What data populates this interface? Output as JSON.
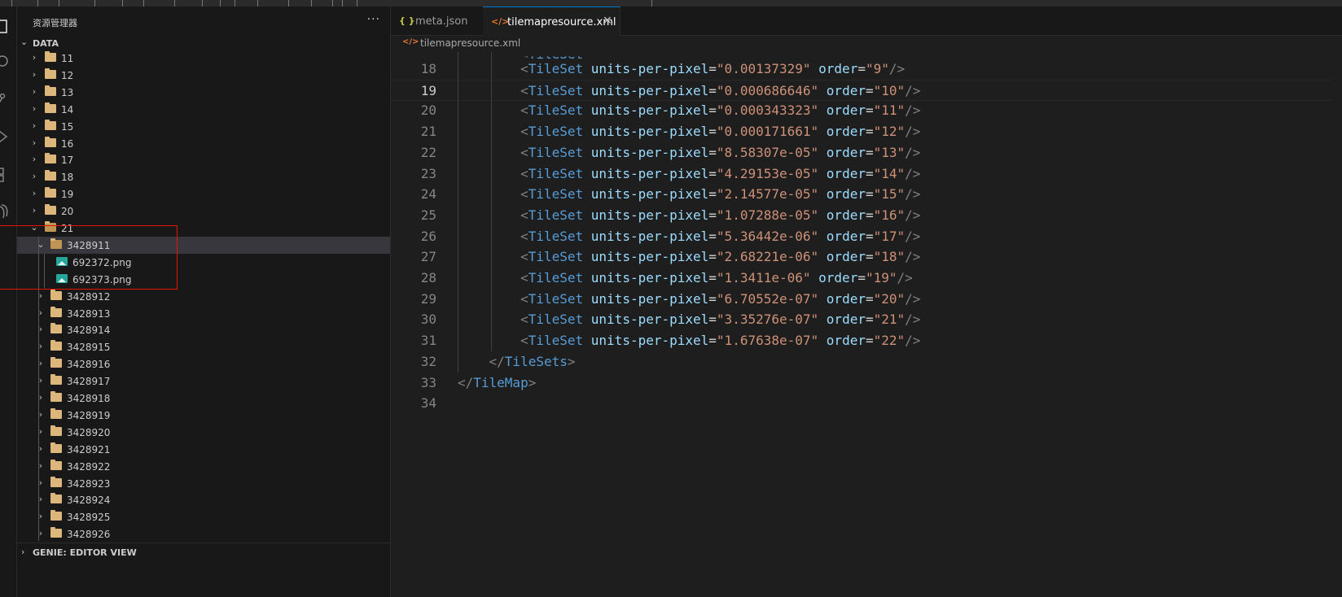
{
  "sidebar": {
    "title": "资源管理器",
    "more": "···",
    "section_label": "DATA",
    "tree": [
      {
        "label": "11",
        "type": "folder",
        "expanded": false,
        "depth": 1
      },
      {
        "label": "12",
        "type": "folder",
        "expanded": false,
        "depth": 1
      },
      {
        "label": "13",
        "type": "folder",
        "expanded": false,
        "depth": 1
      },
      {
        "label": "14",
        "type": "folder",
        "expanded": false,
        "depth": 1
      },
      {
        "label": "15",
        "type": "folder",
        "expanded": false,
        "depth": 1
      },
      {
        "label": "16",
        "type": "folder",
        "expanded": false,
        "depth": 1
      },
      {
        "label": "17",
        "type": "folder",
        "expanded": false,
        "depth": 1
      },
      {
        "label": "18",
        "type": "folder",
        "expanded": false,
        "depth": 1
      },
      {
        "label": "19",
        "type": "folder",
        "expanded": false,
        "depth": 1
      },
      {
        "label": "20",
        "type": "folder",
        "expanded": false,
        "depth": 1
      },
      {
        "label": "21",
        "type": "folder",
        "expanded": true,
        "depth": 1
      },
      {
        "label": "3428911",
        "type": "folder",
        "expanded": true,
        "depth": 2,
        "selected": true
      },
      {
        "label": "692372.png",
        "type": "image",
        "depth": 3
      },
      {
        "label": "692373.png",
        "type": "image",
        "depth": 3
      },
      {
        "label": "3428912",
        "type": "folder",
        "expanded": false,
        "depth": 2
      },
      {
        "label": "3428913",
        "type": "folder",
        "expanded": false,
        "depth": 2
      },
      {
        "label": "3428914",
        "type": "folder",
        "expanded": false,
        "depth": 2
      },
      {
        "label": "3428915",
        "type": "folder",
        "expanded": false,
        "depth": 2
      },
      {
        "label": "3428916",
        "type": "folder",
        "expanded": false,
        "depth": 2
      },
      {
        "label": "3428917",
        "type": "folder",
        "expanded": false,
        "depth": 2
      },
      {
        "label": "3428918",
        "type": "folder",
        "expanded": false,
        "depth": 2
      },
      {
        "label": "3428919",
        "type": "folder",
        "expanded": false,
        "depth": 2
      },
      {
        "label": "3428920",
        "type": "folder",
        "expanded": false,
        "depth": 2
      },
      {
        "label": "3428921",
        "type": "folder",
        "expanded": false,
        "depth": 2
      },
      {
        "label": "3428922",
        "type": "folder",
        "expanded": false,
        "depth": 2
      },
      {
        "label": "3428923",
        "type": "folder",
        "expanded": false,
        "depth": 2
      },
      {
        "label": "3428924",
        "type": "folder",
        "expanded": false,
        "depth": 2
      },
      {
        "label": "3428925",
        "type": "folder",
        "expanded": false,
        "depth": 2
      },
      {
        "label": "3428926",
        "type": "folder",
        "expanded": false,
        "depth": 2
      }
    ],
    "genie_label": "GENIE: EDITOR VIEW"
  },
  "tabs": [
    {
      "icon": "{ }",
      "label": "meta.json",
      "active": false
    },
    {
      "icon": "</>",
      "label": "tilemapresource.xml",
      "active": true
    }
  ],
  "breadcrumb": {
    "icon": "</>",
    "label": "tilemapresource.xml"
  },
  "editor": {
    "current_line": 19,
    "lines": [
      {
        "n": 18,
        "indent": "        ",
        "tokens": [
          [
            "p",
            "<"
          ],
          [
            "t",
            "TileSet"
          ],
          [
            "e",
            " "
          ],
          [
            "a",
            "units-per-pixel"
          ],
          [
            "e",
            "="
          ],
          [
            "v",
            "\"0.00137329\""
          ],
          [
            "e",
            " "
          ],
          [
            "a",
            "order"
          ],
          [
            "e",
            "="
          ],
          [
            "v",
            "\"9\""
          ],
          [
            "p",
            "/>"
          ]
        ]
      },
      {
        "n": 19,
        "indent": "        ",
        "tokens": [
          [
            "p",
            "<"
          ],
          [
            "t",
            "TileSet"
          ],
          [
            "e",
            " "
          ],
          [
            "a",
            "units-per-pixel"
          ],
          [
            "e",
            "="
          ],
          [
            "v",
            "\"0.000686646\""
          ],
          [
            "e",
            " "
          ],
          [
            "a",
            "order"
          ],
          [
            "e",
            "="
          ],
          [
            "v",
            "\"10\""
          ],
          [
            "p",
            "/>"
          ]
        ]
      },
      {
        "n": 20,
        "indent": "        ",
        "tokens": [
          [
            "p",
            "<"
          ],
          [
            "t",
            "TileSet"
          ],
          [
            "e",
            " "
          ],
          [
            "a",
            "units-per-pixel"
          ],
          [
            "e",
            "="
          ],
          [
            "v",
            "\"0.000343323\""
          ],
          [
            "e",
            " "
          ],
          [
            "a",
            "order"
          ],
          [
            "e",
            "="
          ],
          [
            "v",
            "\"11\""
          ],
          [
            "p",
            "/>"
          ]
        ]
      },
      {
        "n": 21,
        "indent": "        ",
        "tokens": [
          [
            "p",
            "<"
          ],
          [
            "t",
            "TileSet"
          ],
          [
            "e",
            " "
          ],
          [
            "a",
            "units-per-pixel"
          ],
          [
            "e",
            "="
          ],
          [
            "v",
            "\"0.000171661\""
          ],
          [
            "e",
            " "
          ],
          [
            "a",
            "order"
          ],
          [
            "e",
            "="
          ],
          [
            "v",
            "\"12\""
          ],
          [
            "p",
            "/>"
          ]
        ]
      },
      {
        "n": 22,
        "indent": "        ",
        "tokens": [
          [
            "p",
            "<"
          ],
          [
            "t",
            "TileSet"
          ],
          [
            "e",
            " "
          ],
          [
            "a",
            "units-per-pixel"
          ],
          [
            "e",
            "="
          ],
          [
            "v",
            "\"8.58307e-05\""
          ],
          [
            "e",
            " "
          ],
          [
            "a",
            "order"
          ],
          [
            "e",
            "="
          ],
          [
            "v",
            "\"13\""
          ],
          [
            "p",
            "/>"
          ]
        ]
      },
      {
        "n": 23,
        "indent": "        ",
        "tokens": [
          [
            "p",
            "<"
          ],
          [
            "t",
            "TileSet"
          ],
          [
            "e",
            " "
          ],
          [
            "a",
            "units-per-pixel"
          ],
          [
            "e",
            "="
          ],
          [
            "v",
            "\"4.29153e-05\""
          ],
          [
            "e",
            " "
          ],
          [
            "a",
            "order"
          ],
          [
            "e",
            "="
          ],
          [
            "v",
            "\"14\""
          ],
          [
            "p",
            "/>"
          ]
        ]
      },
      {
        "n": 24,
        "indent": "        ",
        "tokens": [
          [
            "p",
            "<"
          ],
          [
            "t",
            "TileSet"
          ],
          [
            "e",
            " "
          ],
          [
            "a",
            "units-per-pixel"
          ],
          [
            "e",
            "="
          ],
          [
            "v",
            "\"2.14577e-05\""
          ],
          [
            "e",
            " "
          ],
          [
            "a",
            "order"
          ],
          [
            "e",
            "="
          ],
          [
            "v",
            "\"15\""
          ],
          [
            "p",
            "/>"
          ]
        ]
      },
      {
        "n": 25,
        "indent": "        ",
        "tokens": [
          [
            "p",
            "<"
          ],
          [
            "t",
            "TileSet"
          ],
          [
            "e",
            " "
          ],
          [
            "a",
            "units-per-pixel"
          ],
          [
            "e",
            "="
          ],
          [
            "v",
            "\"1.07288e-05\""
          ],
          [
            "e",
            " "
          ],
          [
            "a",
            "order"
          ],
          [
            "e",
            "="
          ],
          [
            "v",
            "\"16\""
          ],
          [
            "p",
            "/>"
          ]
        ]
      },
      {
        "n": 26,
        "indent": "        ",
        "tokens": [
          [
            "p",
            "<"
          ],
          [
            "t",
            "TileSet"
          ],
          [
            "e",
            " "
          ],
          [
            "a",
            "units-per-pixel"
          ],
          [
            "e",
            "="
          ],
          [
            "v",
            "\"5.36442e-06\""
          ],
          [
            "e",
            " "
          ],
          [
            "a",
            "order"
          ],
          [
            "e",
            "="
          ],
          [
            "v",
            "\"17\""
          ],
          [
            "p",
            "/>"
          ]
        ]
      },
      {
        "n": 27,
        "indent": "        ",
        "tokens": [
          [
            "p",
            "<"
          ],
          [
            "t",
            "TileSet"
          ],
          [
            "e",
            " "
          ],
          [
            "a",
            "units-per-pixel"
          ],
          [
            "e",
            "="
          ],
          [
            "v",
            "\"2.68221e-06\""
          ],
          [
            "e",
            " "
          ],
          [
            "a",
            "order"
          ],
          [
            "e",
            "="
          ],
          [
            "v",
            "\"18\""
          ],
          [
            "p",
            "/>"
          ]
        ]
      },
      {
        "n": 28,
        "indent": "        ",
        "tokens": [
          [
            "p",
            "<"
          ],
          [
            "t",
            "TileSet"
          ],
          [
            "e",
            " "
          ],
          [
            "a",
            "units-per-pixel"
          ],
          [
            "e",
            "="
          ],
          [
            "v",
            "\"1.3411e-06\""
          ],
          [
            "e",
            " "
          ],
          [
            "a",
            "order"
          ],
          [
            "e",
            "="
          ],
          [
            "v",
            "\"19\""
          ],
          [
            "p",
            "/>"
          ]
        ]
      },
      {
        "n": 29,
        "indent": "        ",
        "tokens": [
          [
            "p",
            "<"
          ],
          [
            "t",
            "TileSet"
          ],
          [
            "e",
            " "
          ],
          [
            "a",
            "units-per-pixel"
          ],
          [
            "e",
            "="
          ],
          [
            "v",
            "\"6.70552e-07\""
          ],
          [
            "e",
            " "
          ],
          [
            "a",
            "order"
          ],
          [
            "e",
            "="
          ],
          [
            "v",
            "\"20\""
          ],
          [
            "p",
            "/>"
          ]
        ]
      },
      {
        "n": 30,
        "indent": "        ",
        "tokens": [
          [
            "p",
            "<"
          ],
          [
            "t",
            "TileSet"
          ],
          [
            "e",
            " "
          ],
          [
            "a",
            "units-per-pixel"
          ],
          [
            "e",
            "="
          ],
          [
            "v",
            "\"3.35276e-07\""
          ],
          [
            "e",
            " "
          ],
          [
            "a",
            "order"
          ],
          [
            "e",
            "="
          ],
          [
            "v",
            "\"21\""
          ],
          [
            "p",
            "/>"
          ]
        ]
      },
      {
        "n": 31,
        "indent": "        ",
        "tokens": [
          [
            "p",
            "<"
          ],
          [
            "t",
            "TileSet"
          ],
          [
            "e",
            " "
          ],
          [
            "a",
            "units-per-pixel"
          ],
          [
            "e",
            "="
          ],
          [
            "v",
            "\"1.67638e-07\""
          ],
          [
            "e",
            " "
          ],
          [
            "a",
            "order"
          ],
          [
            "e",
            "="
          ],
          [
            "v",
            "\"22\""
          ],
          [
            "p",
            "/>"
          ]
        ]
      },
      {
        "n": 32,
        "indent": "    ",
        "tokens": [
          [
            "p",
            "</"
          ],
          [
            "t",
            "TileSets"
          ],
          [
            "p",
            ">"
          ]
        ]
      },
      {
        "n": 33,
        "indent": "",
        "tokens": [
          [
            "p",
            "</"
          ],
          [
            "t",
            "TileMap"
          ],
          [
            "p",
            ">"
          ]
        ]
      },
      {
        "n": 34,
        "indent": "",
        "tokens": []
      }
    ]
  },
  "colors": {
    "accent": "#0078d4",
    "highlight_box": "#e51400",
    "folder": "#dcb67a",
    "image_file": "#26a69a"
  }
}
